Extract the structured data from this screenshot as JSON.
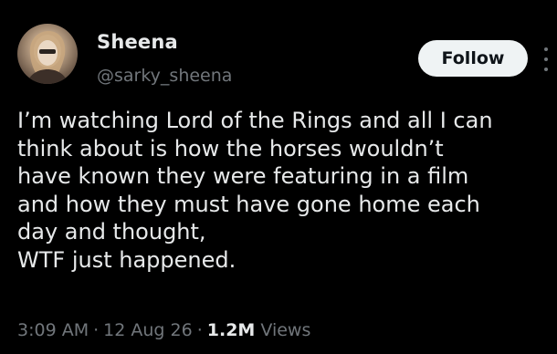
{
  "author": {
    "display_name": "Sheena",
    "handle": "@sarky_sheena"
  },
  "actions": {
    "follow_label": "Follow",
    "more_icon": "more-vertical-icon"
  },
  "tweet": {
    "text_lines": [
      "I’m watching Lord of the Rings and all I can",
      "think about is how the horses wouldn’t",
      "have known they were featuring in a film",
      "and how they must have gone home each",
      "day and thought,",
      "WTF just happened."
    ]
  },
  "meta": {
    "time": "3:09 AM",
    "separator": "·",
    "date": "12 Aug 26",
    "views_count": "1.2M",
    "views_label": "Views"
  },
  "colors": {
    "background": "#000000",
    "primary_text": "#e7e9ea",
    "secondary_text": "#71767b",
    "follow_button_bg": "#eff3f4"
  }
}
